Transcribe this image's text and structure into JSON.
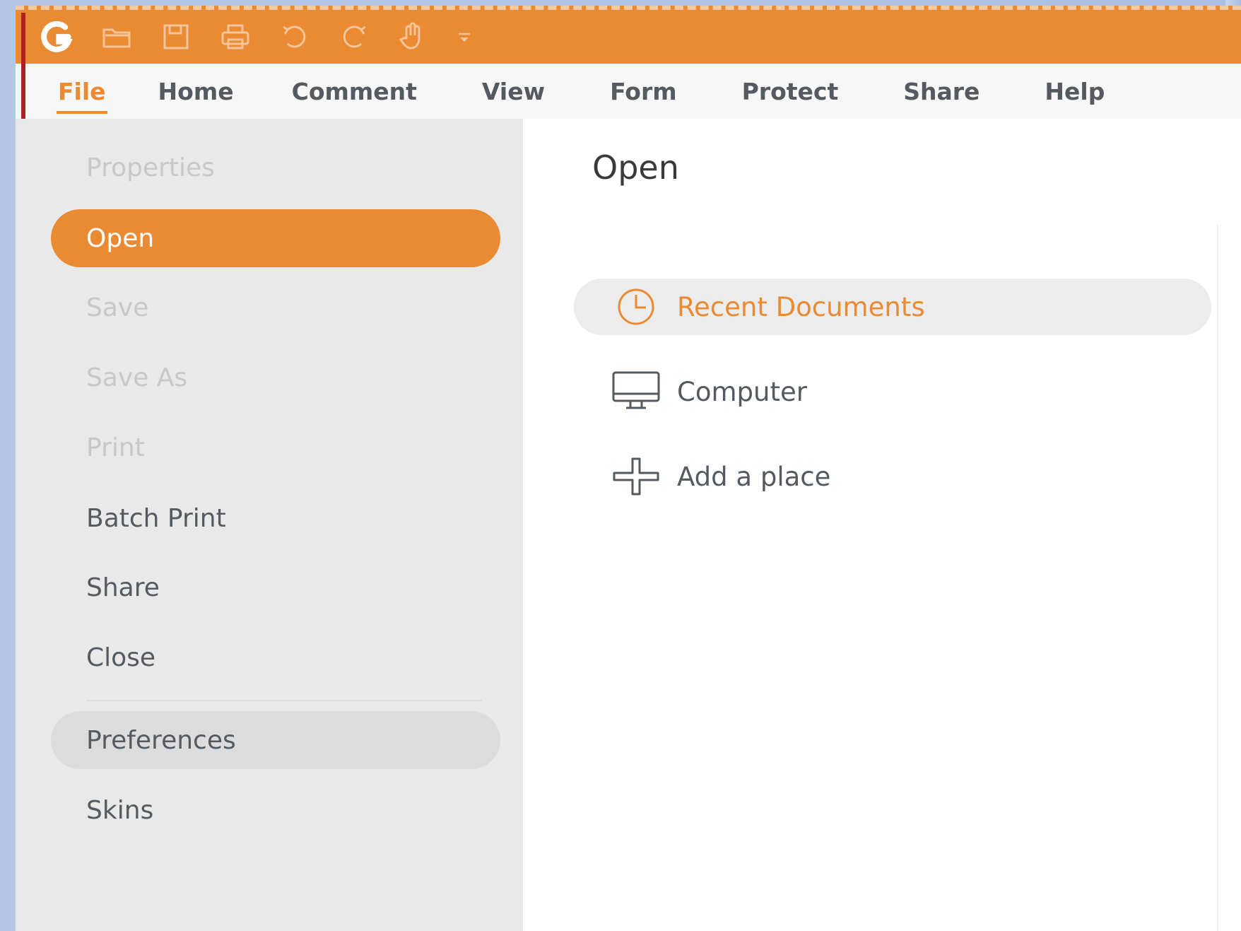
{
  "quick_access": {
    "icons": [
      "app-logo",
      "open-folder-icon",
      "save-icon",
      "print-icon",
      "undo-icon",
      "redo-icon",
      "hand-tool-icon",
      "customize-dropdown-icon"
    ]
  },
  "menu": {
    "tabs": [
      {
        "label": "File",
        "active": true
      },
      {
        "label": "Home"
      },
      {
        "label": "Comment"
      },
      {
        "label": "View"
      },
      {
        "label": "Form"
      },
      {
        "label": "Protect"
      },
      {
        "label": "Share"
      },
      {
        "label": "Help"
      }
    ]
  },
  "sidebar": {
    "items": [
      {
        "label": "Properties",
        "state": "disabled"
      },
      {
        "label": "Open",
        "state": "selected"
      },
      {
        "label": "Save",
        "state": "disabled"
      },
      {
        "label": "Save As",
        "state": "disabled"
      },
      {
        "label": "Print",
        "state": "disabled"
      },
      {
        "label": "Batch Print",
        "state": "normal"
      },
      {
        "label": "Share",
        "state": "normal"
      },
      {
        "label": "Close",
        "state": "normal"
      },
      {
        "label": "Preferences",
        "state": "hover"
      },
      {
        "label": "Skins",
        "state": "normal"
      }
    ]
  },
  "main": {
    "title": "Open",
    "options": [
      {
        "label": "Recent Documents",
        "icon": "clock-icon",
        "selected": true
      },
      {
        "label": "Computer",
        "icon": "monitor-icon"
      },
      {
        "label": "Add a place",
        "icon": "plus-icon"
      }
    ]
  },
  "colors": {
    "accent": "#ea8a32",
    "sidebar_bg": "#e9e9e9",
    "text": "#555a60",
    "disabled_text": "#c8c8c8"
  }
}
